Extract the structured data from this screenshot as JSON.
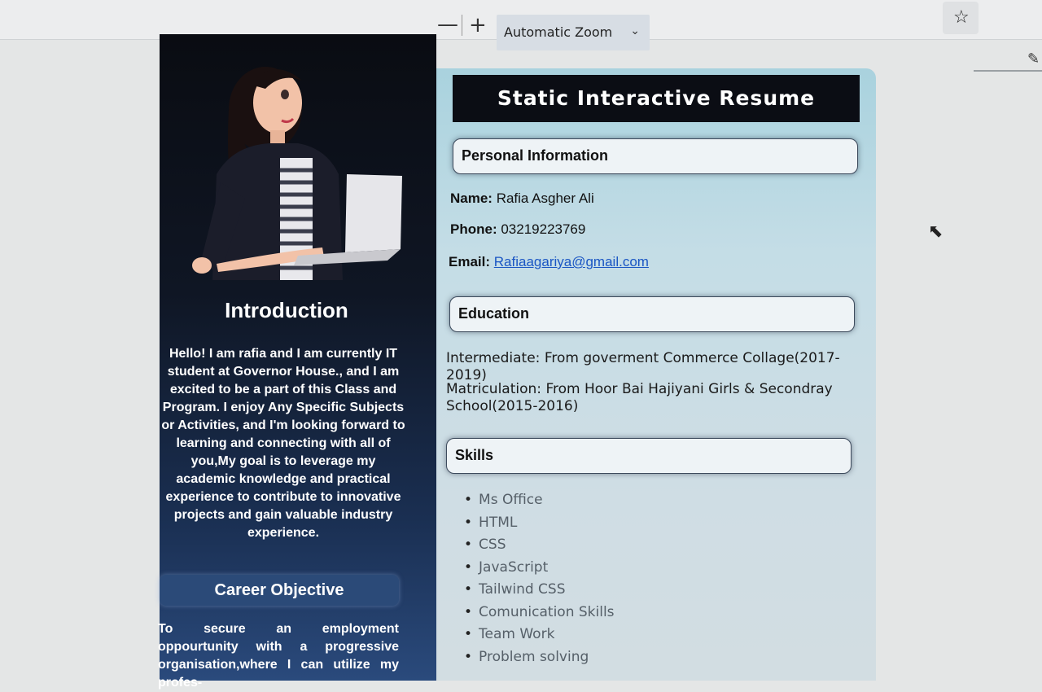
{
  "toolbar": {
    "zoom_out": "—",
    "zoom_in": "+",
    "zoom_label": "Automatic Zoom",
    "zoom_chevron": "⌄",
    "bookmark_icon": "star-icon",
    "draw_icon": "pen-icon"
  },
  "resume": {
    "title": "Static Interactive Resume",
    "left": {
      "intro_heading": "Introduction",
      "intro_text": "Hello! I am rafia and I am currently IT student at Governor House., and I am excited to be a part of this Class and Program. I enjoy Any Specific Subjects or Activities, and I'm looking forward to learning and connecting with all of you,My goal is to leverage my academic knowledge and practical experience to contribute to innovative projects and gain valuable industry experience.",
      "career_heading": "Career Objective",
      "career_text": "To secure an employment oppourtunity with a progressive organisation,where I can utilize my profes-"
    },
    "personal": {
      "heading": "Personal Information",
      "name_label": "Name:",
      "name_value": "Rafia Asgher Ali",
      "phone_label": "Phone:",
      "phone_value": "03219223769",
      "email_label": "Email:",
      "email_value": "Rafiaagariya@gmail.com"
    },
    "education": {
      "heading": "Education",
      "intermediate_label": "Intermediate:",
      "intermediate_value": "From goverment Commerce Collage(2017-2019)",
      "matric_label": "Matriculation:",
      "matric_value": "From Hoor Bai Hajiyani Girls & Secondray School(2015-2016)"
    },
    "skills": {
      "heading": "Skills",
      "items": [
        "Ms Office",
        "HTML",
        "CSS",
        "JavaScript",
        "Tailwind CSS",
        "Comunication Skills",
        "Team Work",
        "Problem solving"
      ]
    }
  },
  "colors": {
    "left_panel": "#0f1624",
    "right_panel": "#c4dde6",
    "title_bar": "#0b0d14",
    "link": "#1a56c4"
  }
}
